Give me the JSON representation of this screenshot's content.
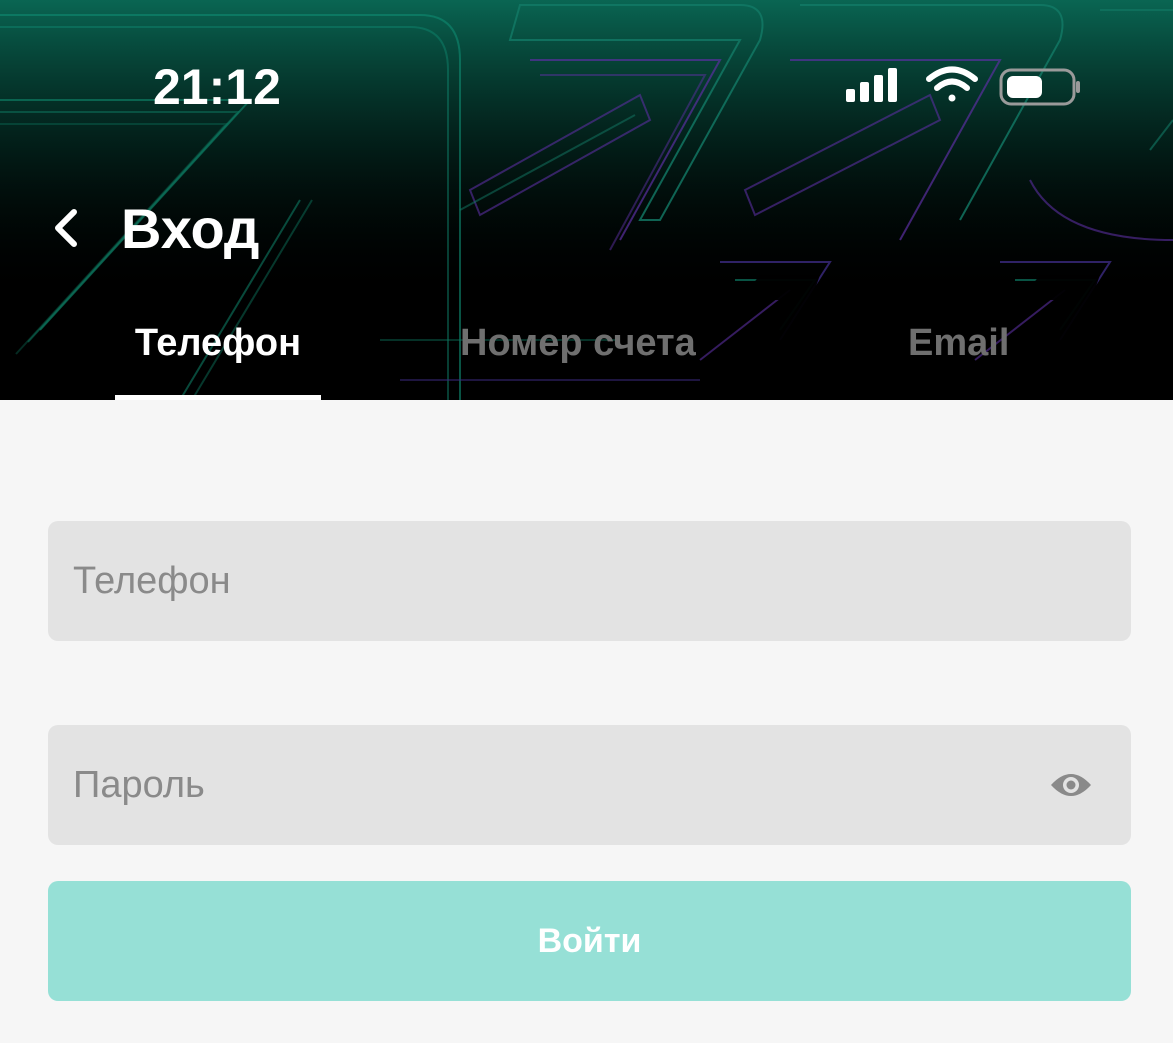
{
  "status_bar": {
    "time": "21:12",
    "icons": [
      "signal-icon",
      "wifi-icon",
      "battery-icon"
    ]
  },
  "header": {
    "back_icon": "chevron-left-icon",
    "title": "Вход"
  },
  "tabs": [
    {
      "label": "Телефон",
      "active": true
    },
    {
      "label": "Номер счета",
      "active": false
    },
    {
      "label": "Email",
      "active": false
    }
  ],
  "form": {
    "phone": {
      "placeholder": "Телефон",
      "value": ""
    },
    "password": {
      "placeholder": "Пароль",
      "value": "",
      "toggle_icon": "eye-icon"
    },
    "submit_label": "Войти"
  },
  "colors": {
    "header_bg": "#000000",
    "accent_green": "#0f8a72",
    "accent_purple": "#5a2fa0",
    "page_bg": "#f6f6f6",
    "field_bg": "#e3e3e3",
    "button_bg": "#96e0d6",
    "inactive_tab": "#6f6f6f"
  }
}
